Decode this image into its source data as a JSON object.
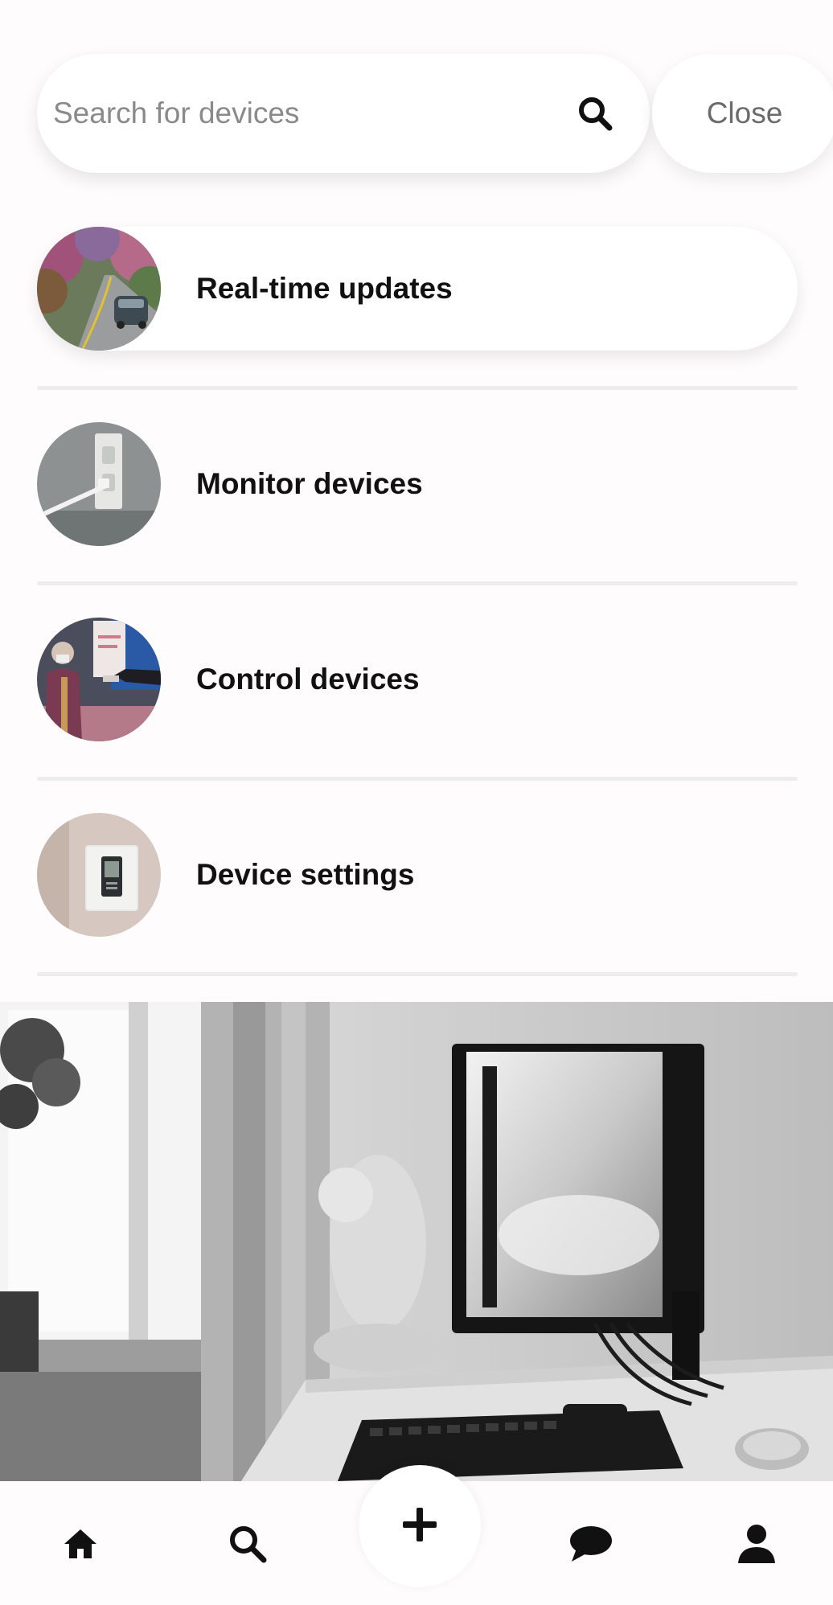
{
  "search": {
    "placeholder": "Search for devices",
    "value": "",
    "icon": "search-icon",
    "close_label": "Close"
  },
  "menu": {
    "items": [
      {
        "label": "Real-time updates",
        "image": "road-car-thumbnail",
        "active": true
      },
      {
        "label": "Monitor devices",
        "image": "wall-outlet-thumbnail",
        "active": false
      },
      {
        "label": "Control devices",
        "image": "people-handoff-thumbnail",
        "active": false
      },
      {
        "label": "Device settings",
        "image": "thermostat-thumbnail",
        "active": false
      }
    ]
  },
  "hero": {
    "image": "desk-monitor-photo-grayscale"
  },
  "bottom_nav": {
    "items": [
      {
        "icon": "home-icon"
      },
      {
        "icon": "search-icon"
      },
      {
        "icon": "plus-icon"
      },
      {
        "icon": "chat-icon"
      },
      {
        "icon": "user-icon"
      }
    ]
  },
  "colors": {
    "background": "#fefcfc",
    "card": "#ffffff",
    "text": "#111111",
    "placeholder": "#8a8a8a",
    "divider": "#eeeded"
  }
}
